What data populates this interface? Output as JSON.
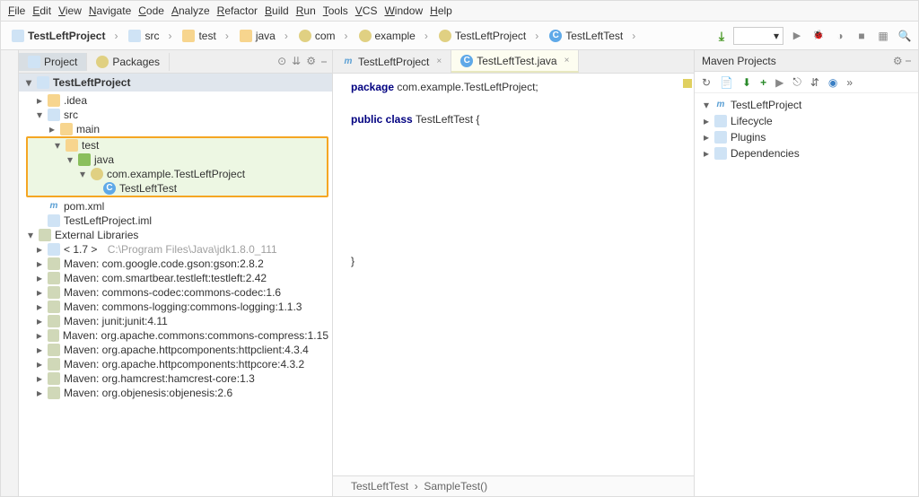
{
  "menubar": [
    "File",
    "Edit",
    "View",
    "Navigate",
    "Code",
    "Analyze",
    "Refactor",
    "Build",
    "Run",
    "Tools",
    "VCS",
    "Window",
    "Help"
  ],
  "crumbs": [
    "TestLeftProject",
    "src",
    "test",
    "java",
    "com",
    "example",
    "TestLeftProject",
    "TestLeftTest"
  ],
  "project": {
    "tab_project": "Project",
    "tab_packages": "Packages",
    "root": "TestLeftProject",
    "root_path": "",
    "idea": ".idea",
    "src": "src",
    "main": "main",
    "test": "test",
    "java": "java",
    "pkg": "com.example.TestLeftProject",
    "cls": "TestLeftTest",
    "pom": "pom.xml",
    "iml": "TestLeftProject.iml",
    "ext": "External Libraries",
    "jdk_ver": "< 1.7 >",
    "jdk_path": "C:\\Program Files\\Java\\jdk1.8.0_111",
    "libs": [
      "Maven: com.google.code.gson:gson:2.8.2",
      "Maven: com.smartbear.testleft:testleft:2.42",
      "Maven: commons-codec:commons-codec:1.6",
      "Maven: commons-logging:commons-logging:1.1.3",
      "Maven: junit:junit:4.11",
      "Maven: org.apache.commons:commons-compress:1.15",
      "Maven: org.apache.httpcomponents:httpclient:4.3.4",
      "Maven: org.apache.httpcomponents:httpcore:4.3.2",
      "Maven: org.hamcrest:hamcrest-core:1.3",
      "Maven: org.objenesis:objenesis:2.6"
    ]
  },
  "editor": {
    "tab1": "TestLeftProject",
    "tab2": "TestLeftTest.java",
    "pkg_kw": "package",
    "pkg_rest": " com.example.TestLeftProject;",
    "pub": "public ",
    "cls_kw": "class ",
    "cls_rest": "TestLeftTest {",
    "close": "}",
    "crumb1": "TestLeftTest",
    "crumb2": "SampleTest()"
  },
  "maven": {
    "title": "Maven Projects",
    "root": "TestLeftProject",
    "lifecycle": "Lifecycle",
    "plugins": "Plugins",
    "deps": "Dependencies"
  }
}
